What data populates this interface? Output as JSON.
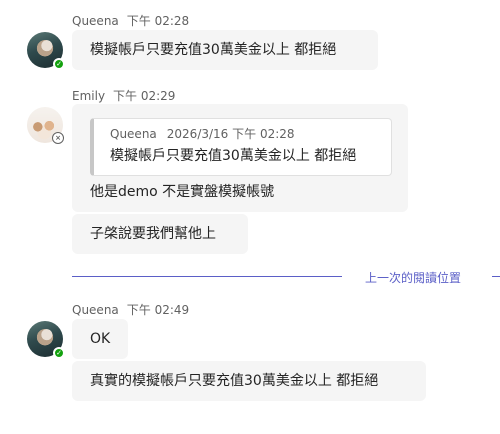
{
  "messages": [
    {
      "sender": "Queena",
      "time": "下午 02:28",
      "bubbles": [
        "模擬帳戶只要充值30萬美金以上 都拒絕"
      ]
    },
    {
      "sender": "Emily",
      "time": "下午 02:29",
      "quote": {
        "sender": "Queena",
        "datetime": "2026/3/16 下午 02:28",
        "text": "模擬帳戶只要充值30萬美金以上 都拒絕"
      },
      "bubbles": [
        "他是demo  不是實盤模擬帳號",
        "子棨說要我們幫他上"
      ]
    },
    {
      "sender": "Queena",
      "time": "下午 02:49",
      "bubbles": [
        "OK",
        "真實的模擬帳戶只要充值30萬美金以上 都拒絕"
      ]
    }
  ],
  "divider": {
    "label": "上一次的閱讀位置"
  },
  "icons": {
    "available": "available-status-icon",
    "offline": "offline-status-icon"
  },
  "colors": {
    "accent": "#5b5fc7",
    "bubble": "#f5f5f5",
    "available": "#13a10e"
  }
}
